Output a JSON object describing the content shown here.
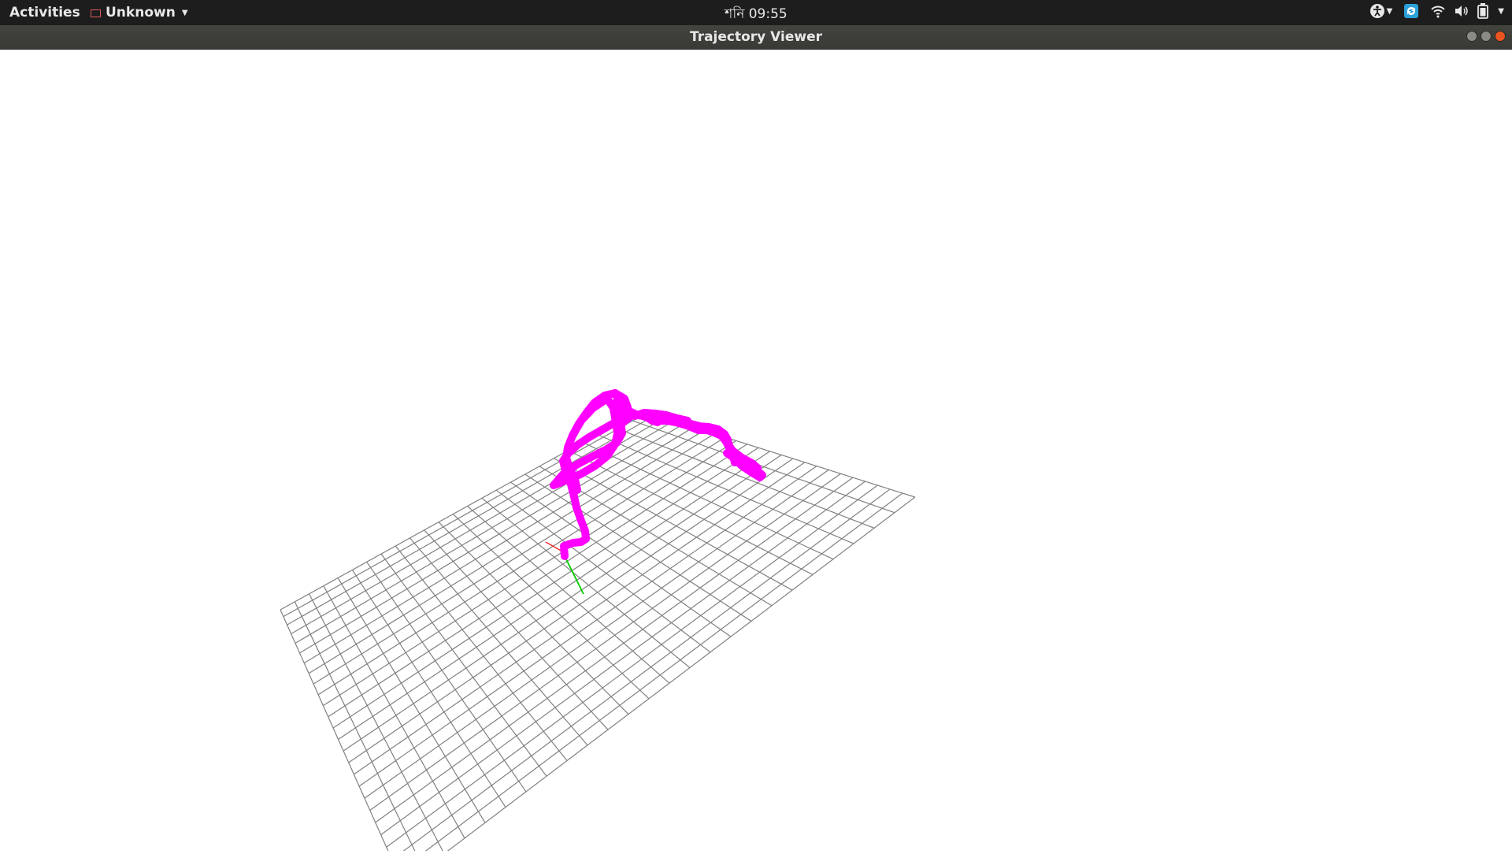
{
  "topbar": {
    "activities": "Activities",
    "app_menu_label": "Unknown",
    "clock": "শনি 09:55"
  },
  "window": {
    "title": "Trajectory Viewer"
  },
  "scene": {
    "grid_color": "#808080",
    "trajectory_color": "#ff00ff",
    "axis_x_color": "#ff0000",
    "axis_y_color": "#00cc00",
    "background": "#ffffff"
  }
}
